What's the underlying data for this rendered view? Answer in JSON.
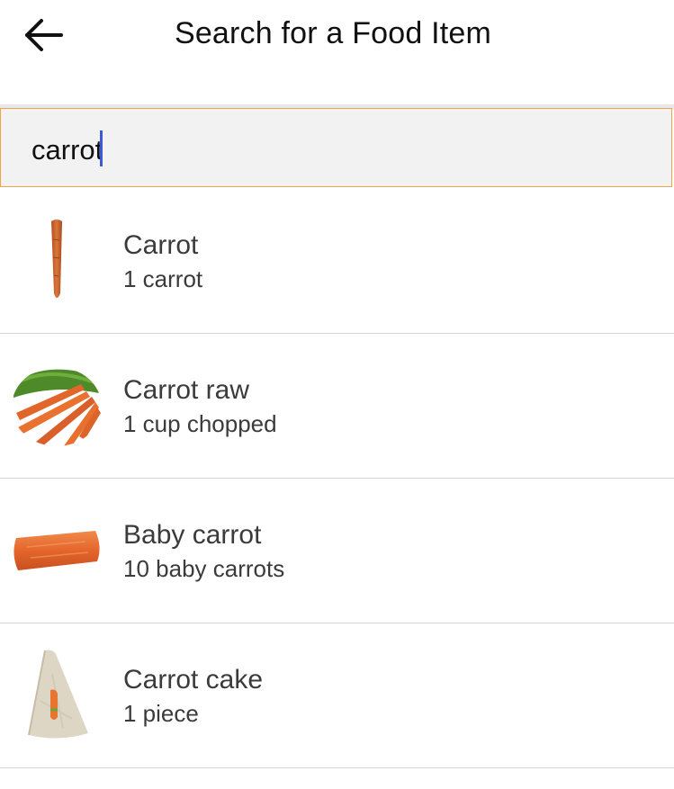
{
  "header": {
    "title": "Search for a Food Item",
    "back_icon": "back-arrow-icon"
  },
  "search": {
    "value": "carrot",
    "placeholder": "",
    "border_color": "#f0a544",
    "caret_color": "#3b5bd6"
  },
  "results": [
    {
      "name": "Carrot",
      "portion": "1 carrot",
      "icon": "carrot-icon"
    },
    {
      "name": "Carrot raw",
      "portion": "1 cup chopped",
      "icon": "carrot-bunch-icon"
    },
    {
      "name": "Baby carrot",
      "portion": "10 baby carrots",
      "icon": "baby-carrot-icon"
    },
    {
      "name": "Carrot cake",
      "portion": "1 piece",
      "icon": "carrot-cake-icon"
    }
  ]
}
